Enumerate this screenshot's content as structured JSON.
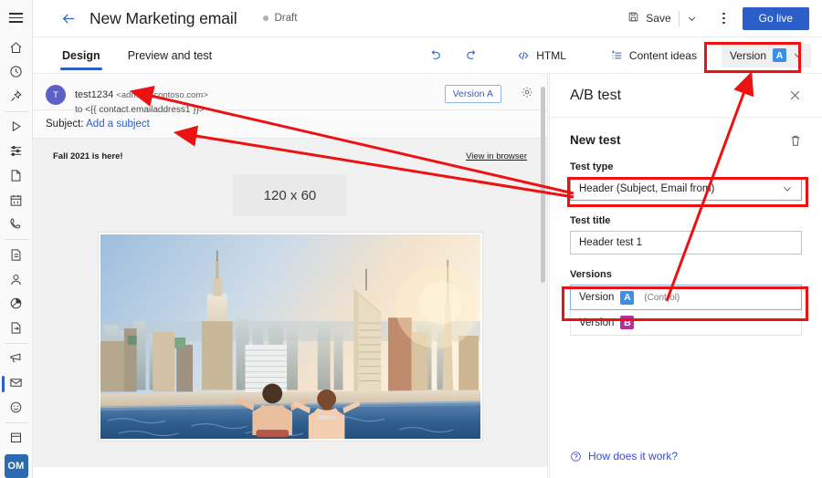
{
  "app": {
    "accent": "#2b5ec7",
    "annotation_color": "#ee1111"
  },
  "rail": {
    "items": [
      {
        "name": "hamburger-menu",
        "label": "Menu"
      },
      {
        "name": "home-icon",
        "label": "Home"
      },
      {
        "name": "recent-icon",
        "label": "Recent"
      },
      {
        "name": "pinned-icon",
        "label": "Pinned"
      },
      {
        "name": "play-icon",
        "label": "Customer journeys"
      },
      {
        "name": "segments-icon",
        "label": "Segments"
      },
      {
        "name": "forms-icon",
        "label": "Forms"
      },
      {
        "name": "calendar-icon",
        "label": "Calendar"
      },
      {
        "name": "phone-icon",
        "label": "Phone"
      },
      {
        "name": "page-icon",
        "label": "Pages"
      },
      {
        "name": "contact-icon",
        "label": "Contacts"
      },
      {
        "name": "analytics-icon",
        "label": "Analytics"
      },
      {
        "name": "document-icon",
        "label": "Documents"
      },
      {
        "name": "megaphone-icon",
        "label": "Campaigns"
      },
      {
        "name": "email-icon",
        "label": "Marketing emails"
      },
      {
        "name": "smiley-icon",
        "label": "Surveys"
      },
      {
        "name": "event-icon",
        "label": "Events"
      }
    ],
    "badge": "OM"
  },
  "header": {
    "back_label": "Back",
    "title": "New Marketing email",
    "status": "Draft",
    "save_label": "Save",
    "save_caret": "More save options",
    "more_label": "More commands",
    "golive_label": "Go live"
  },
  "commandbar": {
    "tabs": [
      {
        "label": "Design",
        "selected": true
      },
      {
        "label": "Preview and test",
        "selected": false
      }
    ],
    "undo_label": "Undo",
    "redo_label": "Redo",
    "html_label": "HTML",
    "content_ideas_label": "Content ideas",
    "version_label": "Version",
    "version_badge": "A"
  },
  "email": {
    "avatar_initial": "T",
    "from_name": "test1234",
    "from_address": "<admin@contoso.com>",
    "to_line": "to <{{ contact.emailaddress1 }}>",
    "version_button": "Version A",
    "settings_label": "Settings",
    "subject_label": "Subject:",
    "subject_link": "Add a subject",
    "preheader": "Fall 2021 is here!",
    "view_in_browser": "View in browser",
    "image_placeholder": "120 x 60",
    "hero_alt": "City skyline rooftop pool"
  },
  "panel": {
    "title": "A/B test",
    "close_label": "Close",
    "test_name": "New test",
    "delete_label": "Delete test",
    "test_type_label": "Test type",
    "test_type_value": "Header (Subject, Email from)",
    "test_title_label": "Test title",
    "test_title_value": "Header test 1",
    "versions_label": "Versions",
    "versions": [
      {
        "label": "Version",
        "badge": "A",
        "note": "(Control)",
        "selected": true
      },
      {
        "label": "Version",
        "badge": "B",
        "note": "",
        "selected": false
      }
    ],
    "help_link": "How does it work?"
  }
}
